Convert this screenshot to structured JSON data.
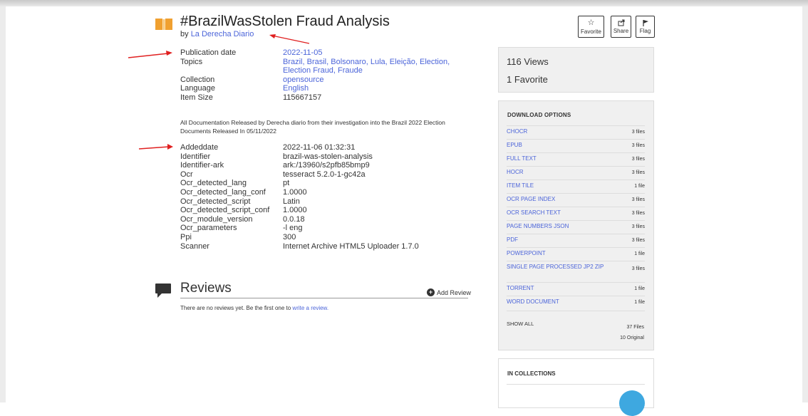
{
  "item": {
    "title": "#BrazilWasStolen Fraud Analysis",
    "by_prefix": "by",
    "author": "La Derecha Diario"
  },
  "metadata_top": [
    {
      "key": "Publication date",
      "value": "2022-11-05",
      "link": true
    },
    {
      "key": "Topics",
      "value": "Brazil, Brasil, Bolsonaro, Lula, Eleição, Election, Election Fraud, Fraude",
      "link": true
    },
    {
      "key": "Collection",
      "value": "opensource",
      "link": true
    },
    {
      "key": "Language",
      "value": "English",
      "link": true
    },
    {
      "key": "Item Size",
      "value": "115667157",
      "link": false
    }
  ],
  "description": "All Documentation Released by Derecha diario from their investigation into the Brazil 2022 Election Documents Released In 05/11/2022",
  "metadata_bottom": [
    {
      "key": "Addeddate",
      "value": "2022-11-06 01:32:31"
    },
    {
      "key": "Identifier",
      "value": "brazil-was-stolen-analysis"
    },
    {
      "key": "Identifier-ark",
      "value": "ark:/13960/s2pfb85bmp9"
    },
    {
      "key": "Ocr",
      "value": "tesseract 5.2.0-1-gc42a"
    },
    {
      "key": "Ocr_detected_lang",
      "value": "pt"
    },
    {
      "key": "Ocr_detected_lang_conf",
      "value": "1.0000"
    },
    {
      "key": "Ocr_detected_script",
      "value": "Latin"
    },
    {
      "key": "Ocr_detected_script_conf",
      "value": "1.0000"
    },
    {
      "key": "Ocr_module_version",
      "value": "0.0.18"
    },
    {
      "key": "Ocr_parameters",
      "value": "-l eng"
    },
    {
      "key": "Ppi",
      "value": "300"
    },
    {
      "key": "Scanner",
      "value": "Internet Archive HTML5 Uploader 1.7.0"
    }
  ],
  "reviews": {
    "title": "Reviews",
    "add_label": "Add Review",
    "empty_text": "There are no reviews yet. Be the first one to",
    "empty_link": "write a review."
  },
  "actions": {
    "favorite": "Favorite",
    "share": "Share",
    "flag": "Flag"
  },
  "stats": {
    "views": "116 Views",
    "favorites": "1 Favorite"
  },
  "downloads": {
    "heading": "DOWNLOAD OPTIONS",
    "items": [
      {
        "name": "CHOCR",
        "count": "3 files"
      },
      {
        "name": "EPUB",
        "count": "3 files"
      },
      {
        "name": "FULL TEXT",
        "count": "3 files"
      },
      {
        "name": "HOCR",
        "count": "3 files"
      },
      {
        "name": "ITEM TILE",
        "count": "1 file"
      },
      {
        "name": "OCR PAGE INDEX",
        "count": "3 files"
      },
      {
        "name": "OCR SEARCH TEXT",
        "count": "3 files"
      },
      {
        "name": "PAGE NUMBERS JSON",
        "count": "3 files"
      },
      {
        "name": "PDF",
        "count": "3 files"
      },
      {
        "name": "POWERPOINT",
        "count": "1 file"
      },
      {
        "name": "SINGLE PAGE PROCESSED JP2 ZIP",
        "count": "3 files"
      },
      {
        "name": "TORRENT",
        "count": "1 file"
      },
      {
        "name": "WORD DOCUMENT",
        "count": "1 file"
      }
    ],
    "show_all": "SHOW ALL",
    "total": "37 Files",
    "original": "10 Original"
  },
  "collections": {
    "heading": "IN COLLECTIONS"
  },
  "colors": {
    "link": "#4b64d9",
    "annotation_arrow": "#e02020",
    "book_icon": "#f0a030",
    "collection_badge": "#3ea8e0"
  }
}
